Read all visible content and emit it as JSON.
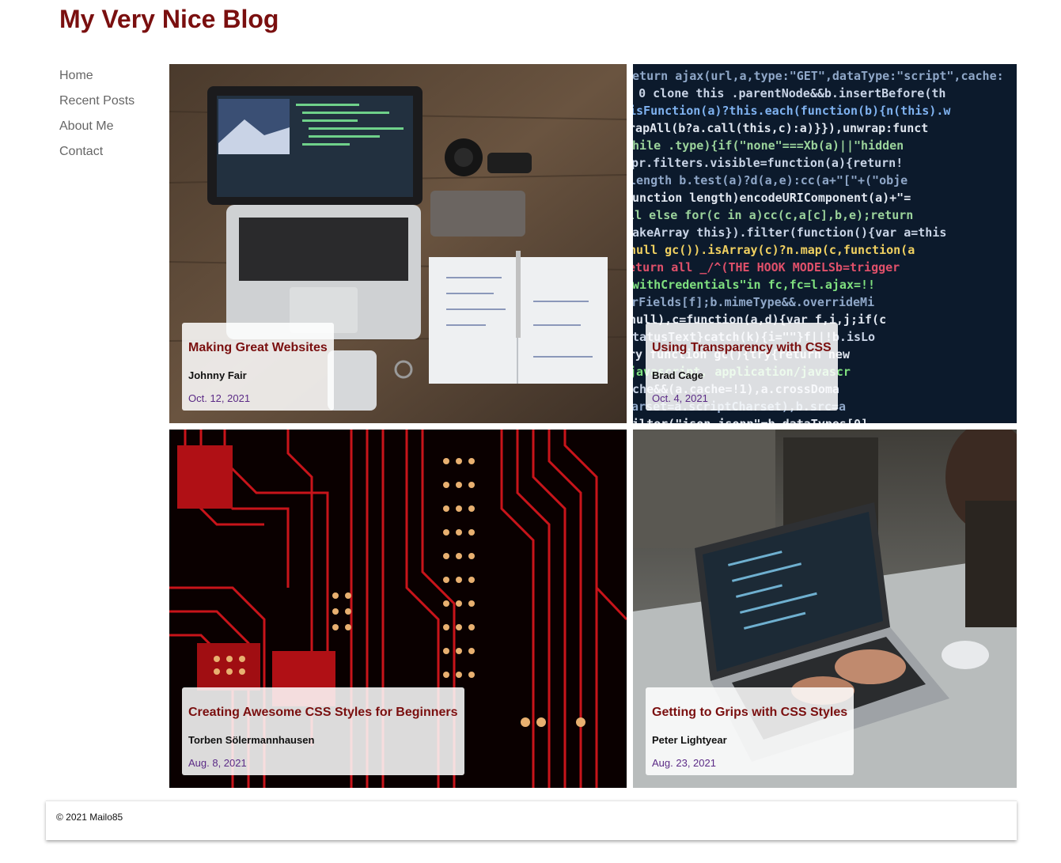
{
  "site": {
    "title": "My Very Nice Blog"
  },
  "nav": {
    "items": [
      "Home",
      "Recent Posts",
      "About Me",
      "Contact"
    ]
  },
  "posts": [
    {
      "title": "Making Great Websites",
      "author": "Johnny Fair",
      "date": "Oct. 12, 2021",
      "image": "laptop-desk-photo"
    },
    {
      "title": "Using Transparency with CSS",
      "author": "Brad Cage",
      "date": "Oct. 4, 2021",
      "image": "code-screen-photo"
    },
    {
      "title": "Creating Awesome CSS Styles for Beginners",
      "author": "Torben Sölermannhausen",
      "date": "Aug. 8, 2021",
      "image": "circuit-board-photo"
    },
    {
      "title": "Getting to Grips with CSS Styles",
      "author": "Peter Lightyear",
      "date": "Aug. 23, 2021",
      "image": "person-laptop-photo"
    }
  ],
  "footer": {
    "copyright": "© 2021 Mailo85"
  },
  "colors": {
    "title": "#7a0f0f",
    "nav": "#666666",
    "date": "#5b2a86"
  }
}
